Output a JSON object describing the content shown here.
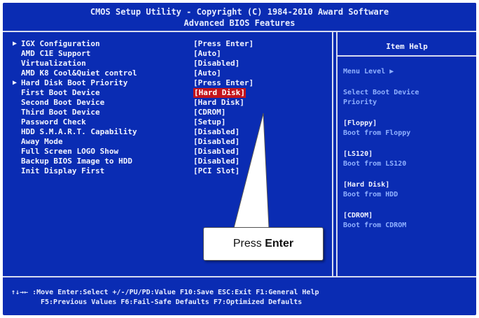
{
  "header": {
    "line1": "CMOS Setup Utility - Copyright (C) 1984-2010 Award Software",
    "line2": "Advanced BIOS Features"
  },
  "settings": [
    {
      "label": "IGX Configuration",
      "value": "[Press Enter]",
      "submenu": true
    },
    {
      "label": "AMD C1E Support",
      "value": "[Auto]",
      "submenu": false
    },
    {
      "label": "Virtualization",
      "value": "[Disabled]",
      "submenu": false
    },
    {
      "label": "AMD K8 Cool&Quiet control",
      "value": "[Auto]",
      "submenu": false
    },
    {
      "label": "Hard Disk Boot Priority",
      "value": "[Press Enter]",
      "submenu": true
    },
    {
      "label": "First Boot Device",
      "value": "[Hard Disk]",
      "submenu": false,
      "selected": true
    },
    {
      "label": "Second Boot Device",
      "value": "[Hard Disk]",
      "submenu": false
    },
    {
      "label": "Third Boot Device",
      "value": "[CDROM]",
      "submenu": false
    },
    {
      "label": "Password Check",
      "value": "[Setup]",
      "submenu": false
    },
    {
      "label": "HDD S.M.A.R.T. Capability",
      "value": "[Disabled]",
      "submenu": false
    },
    {
      "label": "Away Mode",
      "value": "[Disabled]",
      "submenu": false
    },
    {
      "label": "Full Screen LOGO Show",
      "value": "[Disabled]",
      "submenu": false
    },
    {
      "label": "Backup BIOS Image to HDD",
      "value": "[Disabled]",
      "submenu": false
    },
    {
      "label": "Init Display First",
      "value": "[PCI Slot]",
      "submenu": false
    }
  ],
  "submenu_marker": "▶",
  "help": {
    "title": "Item Help",
    "menu_level": "Menu Level  ▶",
    "desc1": "Select Boot Device",
    "desc2": "Priority",
    "opt1_head": "[Floppy]",
    "opt1_desc": "Boot from Floppy",
    "opt2_head": "[LS120]",
    "opt2_desc": "Boot from LS120",
    "opt3_head": "[Hard Disk]",
    "opt3_desc": "Boot from HDD",
    "opt4_head": "[CDROM]",
    "opt4_desc": "Boot from CDROM"
  },
  "footer": {
    "line1": "↑↓→← :Move   Enter:Select   +/-/PU/PD:Value   F10:Save   ESC:Exit   F1:General Help",
    "line2": "F5:Previous Values   F6:Fail-Safe Defaults   F7:Optimized Defaults"
  },
  "callout": {
    "prefix": "Press ",
    "bold": "Enter"
  },
  "colors": {
    "bios_blue": "#0a2cb3",
    "selected_bg": "#c4141c",
    "help_text": "#8fb0ff"
  }
}
